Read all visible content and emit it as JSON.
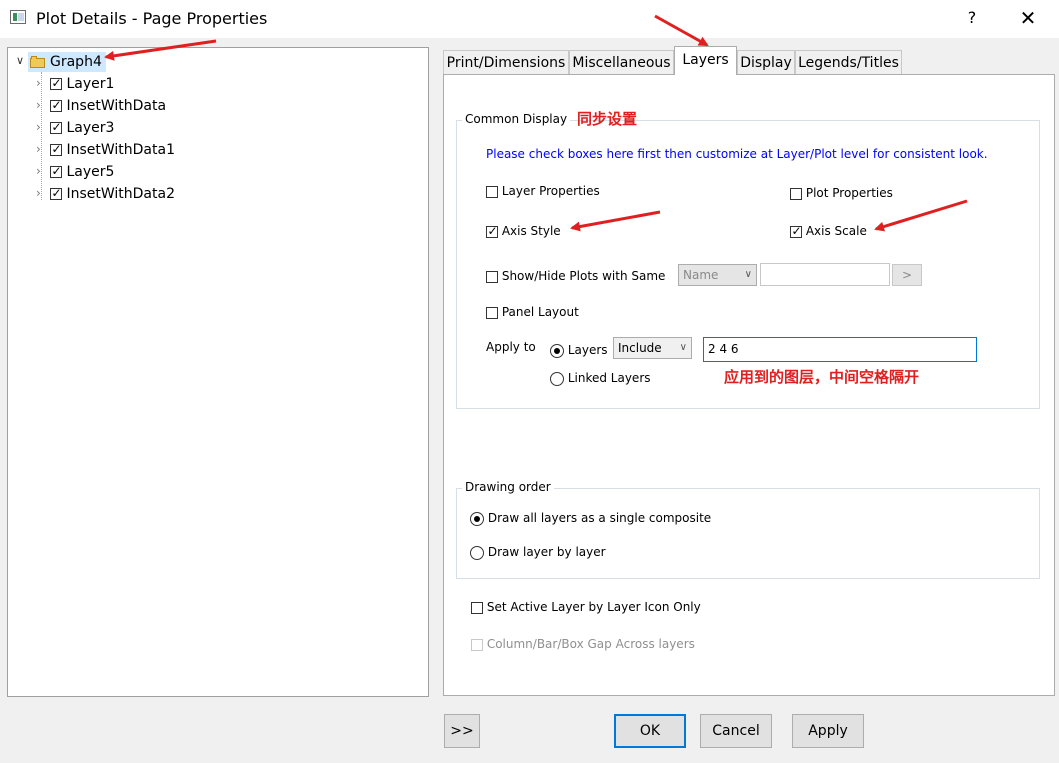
{
  "window": {
    "title": "Plot Details - Page Properties",
    "help": "?",
    "close": "✕"
  },
  "tree": {
    "root": "Graph4",
    "items": [
      {
        "label": "Layer1",
        "checked": true
      },
      {
        "label": "InsetWithData",
        "checked": true
      },
      {
        "label": "Layer3",
        "checked": true
      },
      {
        "label": "InsetWithData1",
        "checked": true
      },
      {
        "label": "Layer5",
        "checked": true
      },
      {
        "label": "InsetWithData2",
        "checked": true
      }
    ]
  },
  "tabs": [
    "Print/Dimensions",
    "Miscellaneous",
    "Layers",
    "Display",
    "Legends/Titles"
  ],
  "active_tab": "Layers",
  "common_display": {
    "title": "Common Display",
    "hint": "Please check boxes here first then customize at Layer/Plot level for consistent look.",
    "layer_properties": {
      "label": "Layer Properties",
      "checked": false
    },
    "plot_properties": {
      "label": "Plot Properties",
      "checked": false
    },
    "axis_style": {
      "label": "Axis Style",
      "checked": true
    },
    "axis_scale": {
      "label": "Axis Scale",
      "checked": true
    },
    "show_hide": {
      "label": "Show/Hide Plots with Same",
      "checked": false,
      "combo_value": "Name",
      "text_value": "",
      "button": ">"
    },
    "panel_layout": {
      "label": "Panel Layout",
      "checked": false
    },
    "apply_to": {
      "label": "Apply to",
      "layers_label": "Layers",
      "linked_label": "Linked Layers",
      "selected": "Layers",
      "combo_value": "Include",
      "layers_text": "2 4 6"
    }
  },
  "drawing_order": {
    "title": "Drawing order",
    "composite_label": "Draw all layers as a single composite",
    "layer_by_layer_label": "Draw layer by layer",
    "selected": "composite"
  },
  "set_active_layer": {
    "label": "Set Active Layer by Layer Icon Only",
    "checked": false
  },
  "gap_across": {
    "label": "Column/Bar/Box Gap Across layers",
    "checked": false,
    "disabled": true
  },
  "buttons": {
    "expand": ">>",
    "ok": "OK",
    "cancel": "Cancel",
    "apply": "Apply"
  },
  "annotations": {
    "sync_setting": "同步设置",
    "apply_layers_note": "应用到的图层，中间空格隔开"
  },
  "colors": {
    "annotation": "#e02020",
    "hint_text": "#0000ff",
    "selection": "#cde8ff",
    "focus": "#0078d7"
  }
}
